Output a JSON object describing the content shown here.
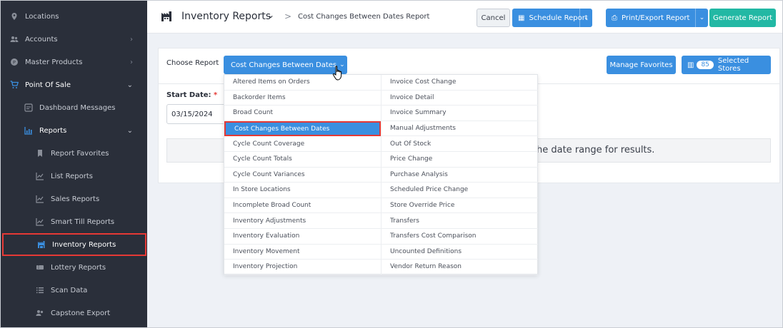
{
  "sidebar": {
    "items": [
      {
        "label": "Locations",
        "icon": "map-pin-icon"
      },
      {
        "label": "Accounts",
        "icon": "users-icon"
      },
      {
        "label": "Master Products",
        "icon": "tag-icon"
      },
      {
        "label": "Point Of Sale",
        "icon": "cart-icon"
      },
      {
        "label": "Dashboard Messages",
        "icon": "dashboard-icon"
      },
      {
        "label": "Reports",
        "icon": "chart-icon"
      },
      {
        "label": "Report Favorites",
        "icon": "bookmark-icon"
      },
      {
        "label": "List Reports",
        "icon": "line-chart-icon"
      },
      {
        "label": "Sales Reports",
        "icon": "line-chart-icon"
      },
      {
        "label": "Smart Till Reports",
        "icon": "line-chart-icon"
      },
      {
        "label": "Inventory Reports",
        "icon": "warehouse-icon"
      },
      {
        "label": "Lottery Reports",
        "icon": "ticket-icon"
      },
      {
        "label": "Scan Data",
        "icon": "list-icon"
      },
      {
        "label": "Capstone Export",
        "icon": "export-icon"
      }
    ]
  },
  "header": {
    "title": "Inventory Reports",
    "separator": ">",
    "current": "Cost Changes Between Dates Report",
    "cancel_label": "Cancel",
    "schedule_label": "Schedule Report",
    "print_label": "Print/Export Report",
    "generate_label": "Generate Report"
  },
  "main": {
    "choose_label": "Choose Report",
    "selected_report": "Cost Changes Between Dates",
    "manage_favorites_label": "Manage Favorites",
    "stores_count": "85",
    "stores_label": "Selected Stores",
    "start_date_label": "Start Date:",
    "required_mark": "*",
    "start_date_value": "03/15/2024",
    "info_text": "he date range for results."
  },
  "dropdown": {
    "col0": [
      "Altered Items on Orders",
      "Backorder Items",
      "Broad Count",
      "Cost Changes Between Dates",
      "Cycle Count Coverage",
      "Cycle Count Totals",
      "Cycle Count Variances",
      "In Store Locations",
      "Incomplete Broad Count",
      "Inventory Adjustments",
      "Inventory Evaluation",
      "Inventory Movement",
      "Inventory Projection"
    ],
    "col1": [
      "Invoice Cost Change",
      "Invoice Detail",
      "Invoice Summary",
      "Manual Adjustments",
      "Out Of Stock",
      "Price Change",
      "Purchase Analysis",
      "Scheduled Price Change",
      "Store Override Price",
      "Transfers",
      "Transfers Cost Comparison",
      "Uncounted Definitions",
      "Vendor Return Reason"
    ]
  },
  "colors": {
    "sidebar_bg": "#2a2f3a",
    "primary": "#3a8fe0",
    "teal": "#22b8a4",
    "highlight": "#e53935"
  }
}
